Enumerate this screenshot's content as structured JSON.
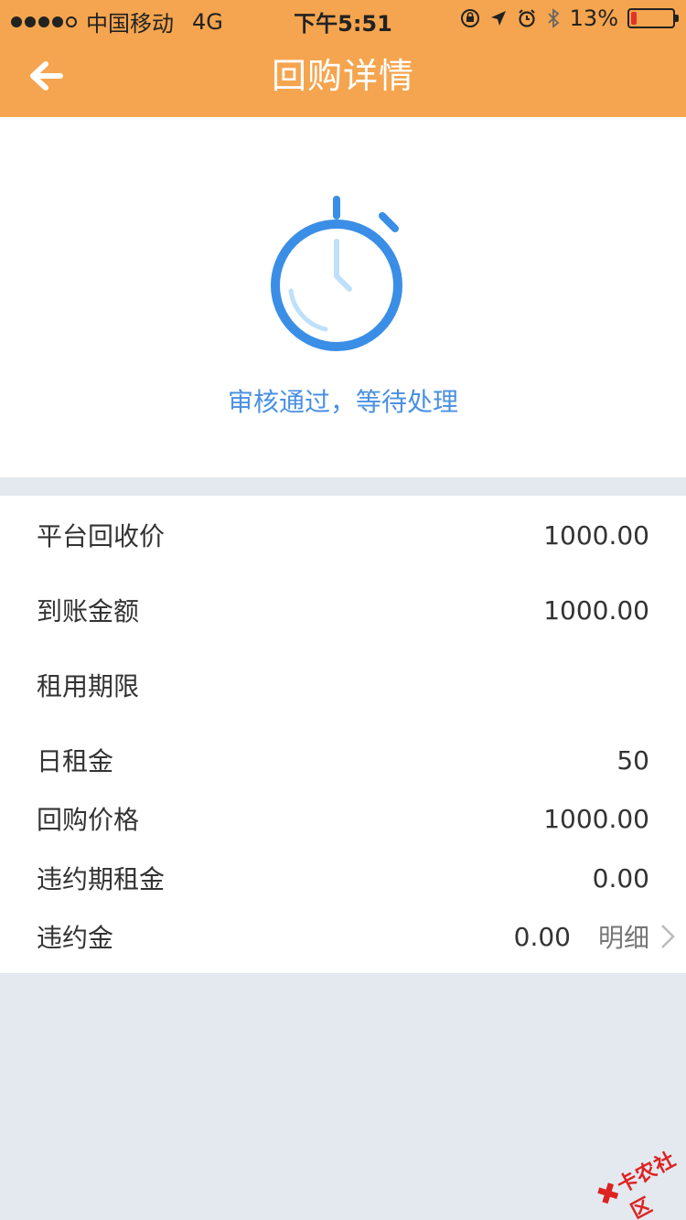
{
  "statusbar": {
    "carrier": "中国移动",
    "network": "4G",
    "time": "下午5:51",
    "battery_percent": "13%",
    "battery_level": 0.13
  },
  "navbar": {
    "title": "回购详情",
    "back_icon": "arrow-left-icon"
  },
  "hero": {
    "icon": "stopwatch-icon",
    "status_text": "审核通过，等待处理"
  },
  "details": {
    "rows": [
      {
        "label": "平台回收价",
        "value": "1000.00"
      },
      {
        "label": "到账金额",
        "value": "1000.00"
      },
      {
        "label": "租用期限",
        "value": ""
      },
      {
        "label": "日租金",
        "value": "50"
      },
      {
        "label": "回购价格",
        "value": "1000.00"
      },
      {
        "label": "违约期租金",
        "value": "0.00"
      },
      {
        "label": "违约金",
        "value": "0.00",
        "link": "明细"
      }
    ]
  },
  "watermark": {
    "text": "卡农社区"
  },
  "colors": {
    "header": "#f5a54f",
    "accent_blue": "#4a90e2",
    "background": "#e3e9ef"
  }
}
